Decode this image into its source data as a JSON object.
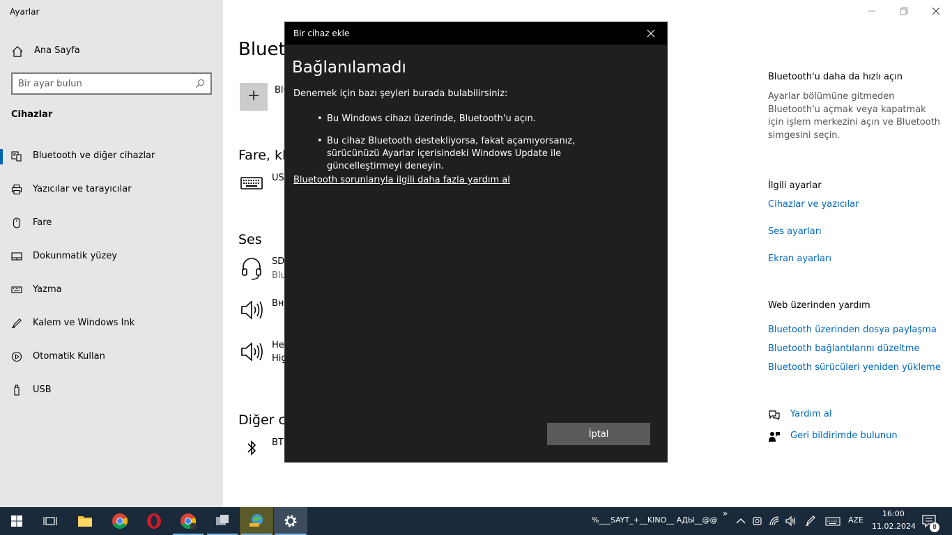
{
  "window": {
    "app_title": "Ayarlar"
  },
  "sidebar": {
    "home": "Ana Sayfa",
    "search_placeholder": "Bir ayar bulun",
    "section": "Cihazlar",
    "items": [
      {
        "label": "Bluetooth ve diğer cihazlar",
        "icon": "bluetooth-devices-icon",
        "active": true
      },
      {
        "label": "Yazıcılar ve tarayıcılar",
        "icon": "printer-icon"
      },
      {
        "label": "Fare",
        "icon": "mouse-icon"
      },
      {
        "label": "Dokunmatik yüzey",
        "icon": "touchpad-icon"
      },
      {
        "label": "Yazma",
        "icon": "keyboard-icon"
      },
      {
        "label": "Kalem ve Windows Ink",
        "icon": "pen-icon"
      },
      {
        "label": "Otomatik Kullan",
        "icon": "autoplay-icon"
      },
      {
        "label": "USB",
        "icon": "usb-icon"
      }
    ]
  },
  "main": {
    "page_title": "Bluetooth",
    "add_label": "Bluetooth",
    "sections": {
      "mouse_keyboard": "Fare, klavye ve kalem",
      "audio": "Ses",
      "other": "Diğer cihazlar"
    },
    "devices": {
      "usb": "USB",
      "sd_name": "SD",
      "sd_sub": "Blu",
      "vne": "Вне",
      "he_name": "He",
      "he_sub": "Hig",
      "bt": "BT"
    }
  },
  "right": {
    "quick_heading": "Bluetooth'u daha da hızlı açın",
    "quick_text": "Ayarlar bölümüne gitmeden Bluetooth'u açmak veya kapatmak için işlem merkezini açın ve Bluetooth simgesini seçin.",
    "related_heading": "İlgili ayarlar",
    "related_links": [
      "Cihazlar ve yazıcılar",
      "Ses ayarları",
      "Ekran ayarları"
    ],
    "web_heading": "Web üzerinden yardım",
    "web_links": [
      "Bluetooth üzerinden dosya paylaşma",
      "Bluetooth bağlantılarını düzeltme",
      "Bluetooth sürücüleri yeniden yükleme"
    ],
    "help": "Yardım al",
    "feedback": "Geri bildirimde bulunun"
  },
  "dialog": {
    "title": "Bir cihaz ekle",
    "heading": "Bağlanılamadı",
    "intro": "Denemek için bazı şeyleri burada bulabilirsiniz:",
    "bullets": [
      "Bu Windows cihazı üzerinde, Bluetooth'u açın.",
      "Bu cihaz Bluetooth destekliyorsa, fakat açamıyorsanız, sürücünüzü Ayarlar içerisindeki Windows Update ile güncelleştirmeyi deneyin."
    ],
    "help_link": "Bluetooth sorunlarıyla ilgili daha fazla yardım al",
    "cancel": "İptal"
  },
  "taskbar": {
    "apps": [
      "start",
      "task-view",
      "file-explorer",
      "chrome",
      "opera",
      "chrome-profile",
      "app-6",
      "app-7",
      "settings"
    ],
    "tray_label": "%___SAYT_+__KINO__ АДЫ__@@",
    "language": "AZE",
    "time": "16:00",
    "date": "11.02.2024",
    "notification_count": "8"
  },
  "colors": {
    "accent": "#0063b1",
    "link": "#0067c0",
    "dialog_bg": "#1f1f1f",
    "taskbar_bg": "#1b2a3a"
  }
}
